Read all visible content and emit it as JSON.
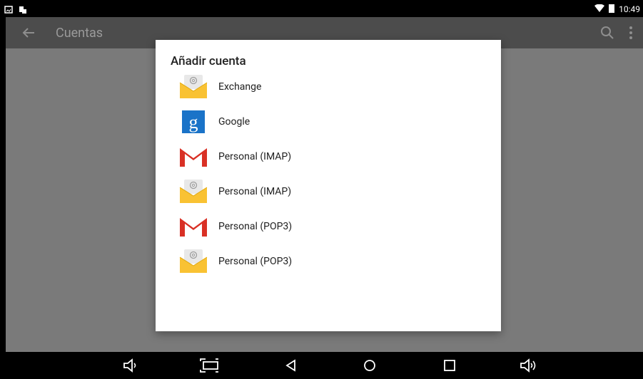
{
  "status_bar": {
    "time": "10:49"
  },
  "app_bar": {
    "title": "Cuentas"
  },
  "dialog": {
    "title": "Añadir cuenta",
    "accounts": [
      {
        "label": "Exchange",
        "icon": "email-envelope-icon"
      },
      {
        "label": "Google",
        "icon": "google-icon"
      },
      {
        "label": "Personal (IMAP)",
        "icon": "gmail-icon"
      },
      {
        "label": "Personal (IMAP)",
        "icon": "email-envelope-icon"
      },
      {
        "label": "Personal (POP3)",
        "icon": "gmail-icon"
      },
      {
        "label": "Personal (POP3)",
        "icon": "email-envelope-icon"
      }
    ]
  },
  "nav_bar": {
    "buttons": [
      "volume-down-icon",
      "screenshot-icon",
      "back-icon",
      "home-icon",
      "recents-icon",
      "volume-up-icon"
    ]
  },
  "colors": {
    "dialog_bg": "#ffffff",
    "scrim": "#7a7a7a",
    "app_bar": "#4c4c4c",
    "envelope_yellow": "#f9c233",
    "google_blue": "#1a73c8",
    "gmail_red": "#d93025"
  }
}
